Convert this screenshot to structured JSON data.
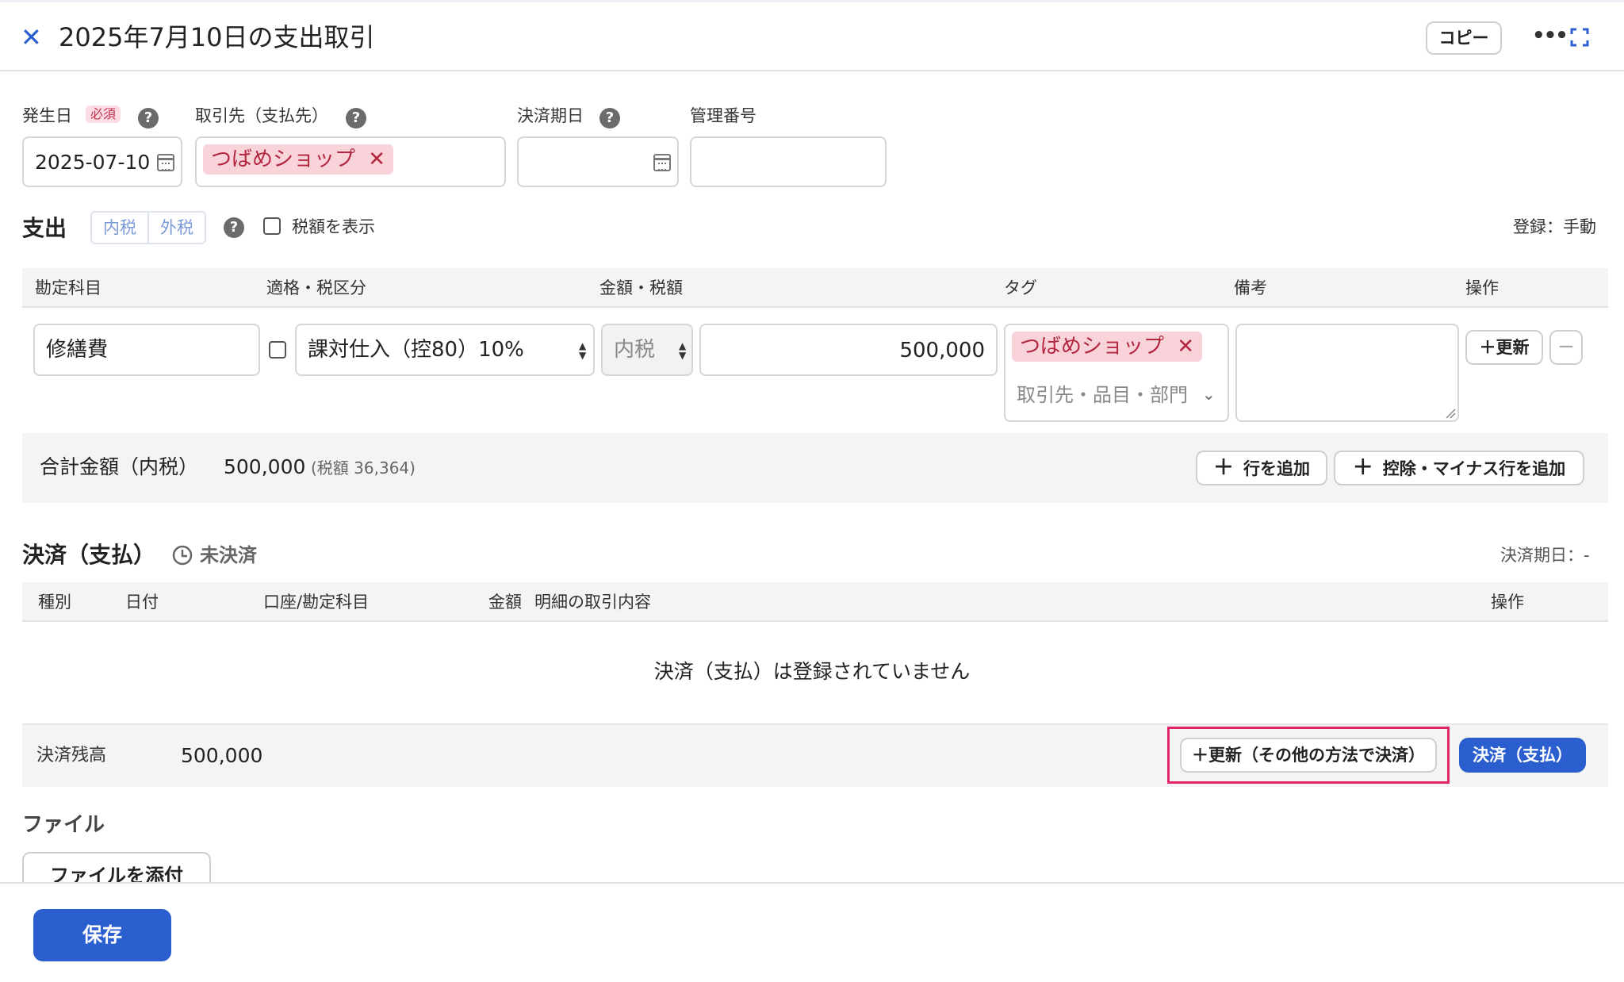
{
  "header": {
    "title": "2025年7月10日の支出取引",
    "copy_label": "コピー"
  },
  "form": {
    "date_label": "発生日",
    "required_badge": "必須",
    "date_value": "2025-07-10",
    "partner_label": "取引先（支払先）",
    "partner_tag": "つばめショップ",
    "due_label": "決済期日",
    "due_value": "",
    "mgmt_label": "管理番号",
    "mgmt_value": ""
  },
  "expense": {
    "title": "支出",
    "tax_modes": [
      "内税",
      "外税"
    ],
    "show_tax_label": "税額を表示",
    "register_label": "登録：手動",
    "columns": [
      "勘定科目",
      "適格・税区分",
      "金額・税額",
      "タグ",
      "備考",
      "操作"
    ],
    "row": {
      "account": "修繕費",
      "tax_category": "課対仕入（控80）10%",
      "tax_mode": "内税",
      "amount": "500,000",
      "tag": "つばめショップ",
      "tag_placeholder": "取引先・品目・部門",
      "memo": "",
      "update_label": "＋更新"
    },
    "total_label": "合計金額（内税）",
    "total_value": "500,000",
    "total_tax": "(税額 36,364)",
    "add_row_label": "行を追加",
    "add_minus_row_label": "控除・マイナス行を追加"
  },
  "settlement": {
    "title": "決済（支払）",
    "status": "未決済",
    "due_label": "決済期日：-",
    "columns": [
      "種別",
      "日付",
      "口座/勘定科目",
      "金額",
      "明細の取引内容",
      "操作"
    ],
    "empty_message": "決済（支払）は登録されていません",
    "balance_label": "決済残高",
    "balance_value": "500,000",
    "update_other_label": "＋更新（その他の方法で決済）",
    "settle_label": "決済（支払）"
  },
  "files": {
    "title": "ファイル",
    "attach_label": "ファイルを添付"
  },
  "footer": {
    "save_label": "保存"
  },
  "colors": {
    "accent": "#2b5fd0",
    "tag_bg": "#f8d3da",
    "tag_fg": "#b3263f",
    "highlight": "#e2246b"
  }
}
